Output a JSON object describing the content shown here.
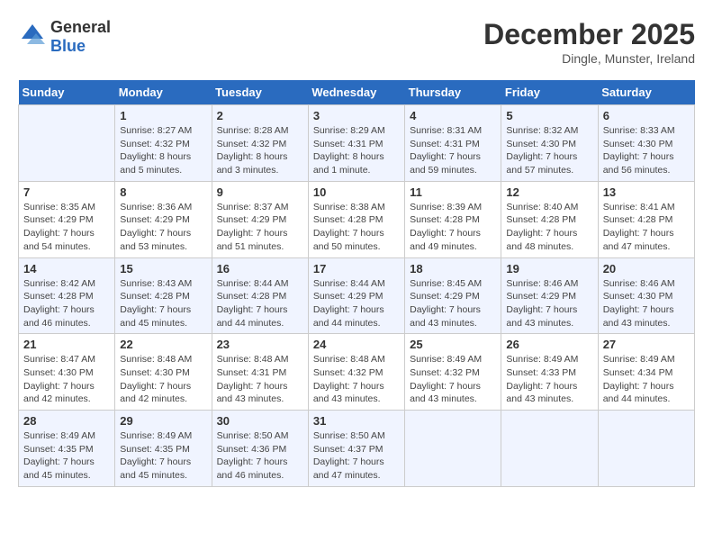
{
  "header": {
    "logo_general": "General",
    "logo_blue": "Blue",
    "month": "December 2025",
    "location": "Dingle, Munster, Ireland"
  },
  "weekdays": [
    "Sunday",
    "Monday",
    "Tuesday",
    "Wednesday",
    "Thursday",
    "Friday",
    "Saturday"
  ],
  "weeks": [
    [
      {
        "day": "",
        "sunrise": "",
        "sunset": "",
        "daylight": ""
      },
      {
        "day": "1",
        "sunrise": "Sunrise: 8:27 AM",
        "sunset": "Sunset: 4:32 PM",
        "daylight": "Daylight: 8 hours and 5 minutes."
      },
      {
        "day": "2",
        "sunrise": "Sunrise: 8:28 AM",
        "sunset": "Sunset: 4:32 PM",
        "daylight": "Daylight: 8 hours and 3 minutes."
      },
      {
        "day": "3",
        "sunrise": "Sunrise: 8:29 AM",
        "sunset": "Sunset: 4:31 PM",
        "daylight": "Daylight: 8 hours and 1 minute."
      },
      {
        "day": "4",
        "sunrise": "Sunrise: 8:31 AM",
        "sunset": "Sunset: 4:31 PM",
        "daylight": "Daylight: 7 hours and 59 minutes."
      },
      {
        "day": "5",
        "sunrise": "Sunrise: 8:32 AM",
        "sunset": "Sunset: 4:30 PM",
        "daylight": "Daylight: 7 hours and 57 minutes."
      },
      {
        "day": "6",
        "sunrise": "Sunrise: 8:33 AM",
        "sunset": "Sunset: 4:30 PM",
        "daylight": "Daylight: 7 hours and 56 minutes."
      }
    ],
    [
      {
        "day": "7",
        "sunrise": "Sunrise: 8:35 AM",
        "sunset": "Sunset: 4:29 PM",
        "daylight": "Daylight: 7 hours and 54 minutes."
      },
      {
        "day": "8",
        "sunrise": "Sunrise: 8:36 AM",
        "sunset": "Sunset: 4:29 PM",
        "daylight": "Daylight: 7 hours and 53 minutes."
      },
      {
        "day": "9",
        "sunrise": "Sunrise: 8:37 AM",
        "sunset": "Sunset: 4:29 PM",
        "daylight": "Daylight: 7 hours and 51 minutes."
      },
      {
        "day": "10",
        "sunrise": "Sunrise: 8:38 AM",
        "sunset": "Sunset: 4:28 PM",
        "daylight": "Daylight: 7 hours and 50 minutes."
      },
      {
        "day": "11",
        "sunrise": "Sunrise: 8:39 AM",
        "sunset": "Sunset: 4:28 PM",
        "daylight": "Daylight: 7 hours and 49 minutes."
      },
      {
        "day": "12",
        "sunrise": "Sunrise: 8:40 AM",
        "sunset": "Sunset: 4:28 PM",
        "daylight": "Daylight: 7 hours and 48 minutes."
      },
      {
        "day": "13",
        "sunrise": "Sunrise: 8:41 AM",
        "sunset": "Sunset: 4:28 PM",
        "daylight": "Daylight: 7 hours and 47 minutes."
      }
    ],
    [
      {
        "day": "14",
        "sunrise": "Sunrise: 8:42 AM",
        "sunset": "Sunset: 4:28 PM",
        "daylight": "Daylight: 7 hours and 46 minutes."
      },
      {
        "day": "15",
        "sunrise": "Sunrise: 8:43 AM",
        "sunset": "Sunset: 4:28 PM",
        "daylight": "Daylight: 7 hours and 45 minutes."
      },
      {
        "day": "16",
        "sunrise": "Sunrise: 8:44 AM",
        "sunset": "Sunset: 4:28 PM",
        "daylight": "Daylight: 7 hours and 44 minutes."
      },
      {
        "day": "17",
        "sunrise": "Sunrise: 8:44 AM",
        "sunset": "Sunset: 4:29 PM",
        "daylight": "Daylight: 7 hours and 44 minutes."
      },
      {
        "day": "18",
        "sunrise": "Sunrise: 8:45 AM",
        "sunset": "Sunset: 4:29 PM",
        "daylight": "Daylight: 7 hours and 43 minutes."
      },
      {
        "day": "19",
        "sunrise": "Sunrise: 8:46 AM",
        "sunset": "Sunset: 4:29 PM",
        "daylight": "Daylight: 7 hours and 43 minutes."
      },
      {
        "day": "20",
        "sunrise": "Sunrise: 8:46 AM",
        "sunset": "Sunset: 4:30 PM",
        "daylight": "Daylight: 7 hours and 43 minutes."
      }
    ],
    [
      {
        "day": "21",
        "sunrise": "Sunrise: 8:47 AM",
        "sunset": "Sunset: 4:30 PM",
        "daylight": "Daylight: 7 hours and 42 minutes."
      },
      {
        "day": "22",
        "sunrise": "Sunrise: 8:48 AM",
        "sunset": "Sunset: 4:30 PM",
        "daylight": "Daylight: 7 hours and 42 minutes."
      },
      {
        "day": "23",
        "sunrise": "Sunrise: 8:48 AM",
        "sunset": "Sunset: 4:31 PM",
        "daylight": "Daylight: 7 hours and 43 minutes."
      },
      {
        "day": "24",
        "sunrise": "Sunrise: 8:48 AM",
        "sunset": "Sunset: 4:32 PM",
        "daylight": "Daylight: 7 hours and 43 minutes."
      },
      {
        "day": "25",
        "sunrise": "Sunrise: 8:49 AM",
        "sunset": "Sunset: 4:32 PM",
        "daylight": "Daylight: 7 hours and 43 minutes."
      },
      {
        "day": "26",
        "sunrise": "Sunrise: 8:49 AM",
        "sunset": "Sunset: 4:33 PM",
        "daylight": "Daylight: 7 hours and 43 minutes."
      },
      {
        "day": "27",
        "sunrise": "Sunrise: 8:49 AM",
        "sunset": "Sunset: 4:34 PM",
        "daylight": "Daylight: 7 hours and 44 minutes."
      }
    ],
    [
      {
        "day": "28",
        "sunrise": "Sunrise: 8:49 AM",
        "sunset": "Sunset: 4:35 PM",
        "daylight": "Daylight: 7 hours and 45 minutes."
      },
      {
        "day": "29",
        "sunrise": "Sunrise: 8:49 AM",
        "sunset": "Sunset: 4:35 PM",
        "daylight": "Daylight: 7 hours and 45 minutes."
      },
      {
        "day": "30",
        "sunrise": "Sunrise: 8:50 AM",
        "sunset": "Sunset: 4:36 PM",
        "daylight": "Daylight: 7 hours and 46 minutes."
      },
      {
        "day": "31",
        "sunrise": "Sunrise: 8:50 AM",
        "sunset": "Sunset: 4:37 PM",
        "daylight": "Daylight: 7 hours and 47 minutes."
      },
      {
        "day": "",
        "sunrise": "",
        "sunset": "",
        "daylight": ""
      },
      {
        "day": "",
        "sunrise": "",
        "sunset": "",
        "daylight": ""
      },
      {
        "day": "",
        "sunrise": "",
        "sunset": "",
        "daylight": ""
      }
    ]
  ]
}
